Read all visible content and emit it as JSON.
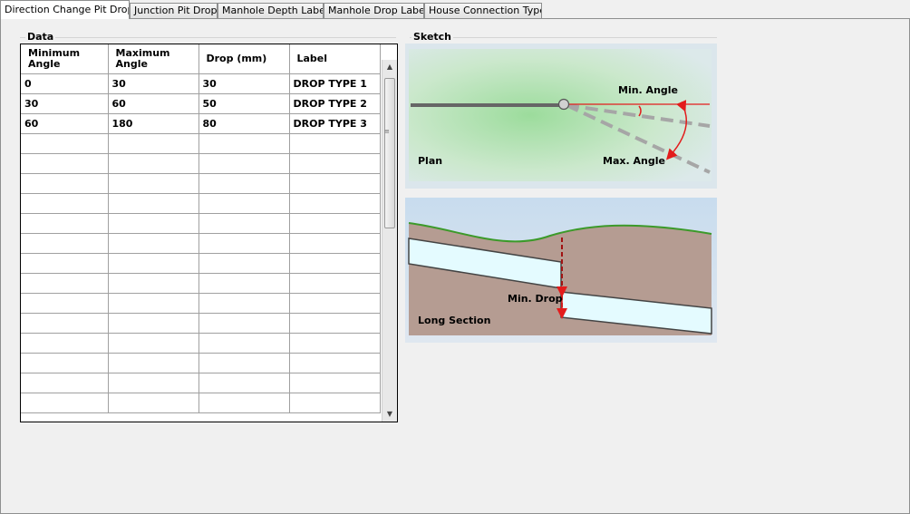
{
  "tabs": [
    {
      "label": "Direction Change Pit Drops",
      "active": true
    },
    {
      "label": "Junction Pit Drops",
      "active": false
    },
    {
      "label": "Manhole Depth Labels",
      "active": false
    },
    {
      "label": "Manhole Drop Labels",
      "active": false
    },
    {
      "label": "House Connection Types",
      "active": false
    }
  ],
  "data_group": {
    "title": "Data",
    "columns": [
      "Minimum Angle",
      "Maximum Angle",
      "Drop (mm)",
      "Label"
    ],
    "rows": [
      [
        "0",
        "30",
        "30",
        "DROP TYPE 1"
      ],
      [
        "30",
        "60",
        "50",
        "DROP TYPE 2"
      ],
      [
        "60",
        "180",
        "80",
        "DROP TYPE 3"
      ],
      [
        "",
        "",
        "",
        ""
      ],
      [
        "",
        "",
        "",
        ""
      ],
      [
        "",
        "",
        "",
        ""
      ],
      [
        "",
        "",
        "",
        ""
      ],
      [
        "",
        "",
        "",
        ""
      ],
      [
        "",
        "",
        "",
        ""
      ],
      [
        "",
        "",
        "",
        ""
      ],
      [
        "",
        "",
        "",
        ""
      ],
      [
        "",
        "",
        "",
        ""
      ],
      [
        "",
        "",
        "",
        ""
      ],
      [
        "",
        "",
        "",
        ""
      ],
      [
        "",
        "",
        "",
        ""
      ],
      [
        "",
        "",
        "",
        ""
      ],
      [
        "",
        "",
        "",
        ""
      ]
    ]
  },
  "sketch_group": {
    "title": "Sketch",
    "plan_label": "Plan",
    "min_angle_label": "Min. Angle",
    "max_angle_label": "Max. Angle",
    "long_section_label": "Long Section",
    "min_drop_label": "Min. Drop"
  },
  "colors": {
    "grid_border": "#000000",
    "cell_border": "#a0a0a0",
    "tab_border": "#8e8f8f",
    "panel_bg": "#f0f0f0",
    "accent_red": "#e31c1c",
    "ground_green": "#3c9a2a",
    "soil": "#b59c92",
    "pipe_fill": "#e4fbff"
  }
}
